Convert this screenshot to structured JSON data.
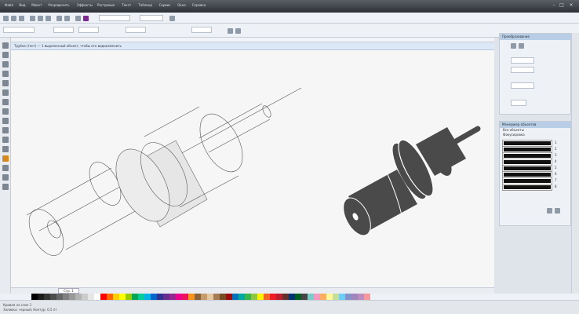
{
  "titlebar": {
    "menu": [
      "Файл",
      "Вид",
      "Макет",
      "Упорядочить",
      "Эффекты",
      "Растровые",
      "Текст",
      "Таблица",
      "Сервис",
      "Окно",
      "Справка"
    ]
  },
  "banner": {
    "text": "Трубка (тест) — 1 выделенный объект, чтобы его видоизменить"
  },
  "canvas_tab": {
    "label": "Стр. 1"
  },
  "status": {
    "line1": "Кривая на слое 1",
    "line2": "Заливка: черный; Контур: 0,5 пт"
  },
  "docker_top": {
    "title": "Преобразование"
  },
  "docker_bottom": {
    "title": "Менеджер объектов",
    "options": [
      "Все объекты",
      "Фокусировка"
    ]
  },
  "stroke_values": [
    "1",
    "2",
    "3",
    "4",
    "5",
    "6",
    "7",
    "8"
  ],
  "icons": [
    "select-tool-icon",
    "shape-tool-icon",
    "zoom-tool-icon",
    "freehand-tool-icon",
    "rectangle-tool-icon",
    "ellipse-tool-icon",
    "text-tool-icon",
    "fill-tool-icon"
  ],
  "colors": {
    "accent": "#5b8fd1",
    "cylinder_fill": "#4a4a4a",
    "palette": [
      "#000000",
      "#1a1a1a",
      "#333333",
      "#4d4d4d",
      "#666666",
      "#808080",
      "#999999",
      "#b3b3b3",
      "#cccccc",
      "#e6e6e6",
      "#ffffff",
      "#ff0000",
      "#ff6600",
      "#ffcc00",
      "#ffff00",
      "#99cc00",
      "#00a651",
      "#00cc99",
      "#00b3e6",
      "#0066cc",
      "#2e3192",
      "#662d91",
      "#92278f",
      "#ec008c",
      "#ed145b",
      "#f7941d",
      "#8c6239",
      "#c69c6d",
      "#e6c8a0",
      "#a67c52",
      "#754c24",
      "#9e0b0f",
      "#0072bc",
      "#00a99d",
      "#39b54a",
      "#8dc63f",
      "#fff200",
      "#f26522",
      "#ee1c25",
      "#bd1e2d",
      "#662d2d",
      "#003471",
      "#005e20",
      "#464646",
      "#7accc8",
      "#f49ac1",
      "#fbaf5d",
      "#fff799",
      "#c4df9b",
      "#6dcff6",
      "#8393ca",
      "#a186be",
      "#bc8dbf",
      "#f6989d"
    ]
  }
}
